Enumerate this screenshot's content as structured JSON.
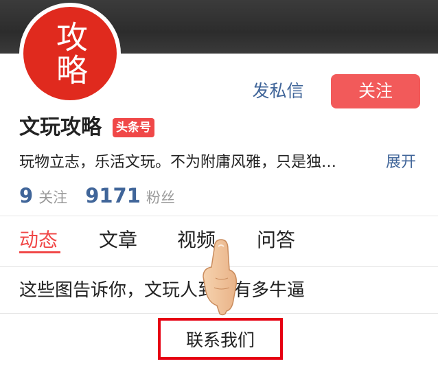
{
  "profile": {
    "avatar_text": "攻略",
    "name": "文玩攻略",
    "badge": "头条号",
    "bio": "玩物立志，乐活文玩。不为附庸风雅，只是独…",
    "expand": "展开"
  },
  "actions": {
    "message": "发私信",
    "follow": "关注"
  },
  "stats": {
    "following_count": "9",
    "following_label": "关注",
    "fans_count": "9171",
    "fans_label": "粉丝"
  },
  "tabs": [
    {
      "label": "动态",
      "active": true
    },
    {
      "label": "文章",
      "active": false
    },
    {
      "label": "视频",
      "active": false
    },
    {
      "label": "问答",
      "active": false
    }
  ],
  "feed": {
    "headline": "这些图告诉你，文玩人到底有多牛逼"
  },
  "contact": {
    "label": "联系我们"
  },
  "colors": {
    "accent_red": "#f25a5a",
    "link_blue": "#406599",
    "annotation_red": "#e60012"
  },
  "icons": {
    "pointer": "pointing-hand-icon"
  }
}
